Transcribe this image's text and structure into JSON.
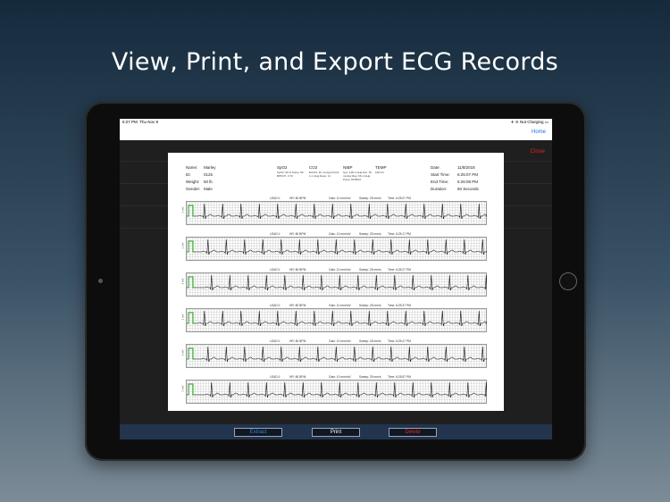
{
  "headline": "View, Print, and Export ECG Records",
  "status_bar": {
    "time": "6:27 PM",
    "date": "Thu Nov 8",
    "battery": "Not Charging"
  },
  "nav": {
    "home_label": "Home"
  },
  "close_label": "Close",
  "buttons": {
    "extract": "Extract",
    "print": "Print",
    "delete": "Delete"
  },
  "record": {
    "name_label": "Name:",
    "name_value": "Marley",
    "id_label": "ID:",
    "id_value": "0125",
    "weight_label": "Weight:",
    "weight_value": "50 lb",
    "gender_label": "Gender:",
    "gender_value": "Male",
    "spo2_title": "SpO2",
    "spo2_detail": "SpO2: 99 %  Pulse: 80 BPM  PI: 3.70",
    "co2_title": "CO2",
    "co2_detail": "EtCO2: 40 mmHg  FiCO2: 1 mmHg  Resp: 11",
    "nibp_title": "NIBP",
    "nibp_detail": "Sys: 128 mmHg  Dia: 78 mmHg  Map: 96 mmHg  Pulse: 80 BPM",
    "temp_title": "TEMP",
    "temp_detail": "100.6 F",
    "date_label": "Date:",
    "date_value": "11/8/2018",
    "start_label": "Start Time:",
    "start_value": "6:25:07 PM",
    "end_label": "End Time:",
    "end_value": "6:26:08 PM",
    "duration_label": "Duration:",
    "duration_value": "60 Seconds"
  },
  "strips": [
    {
      "lead": "LEAD II",
      "hr": "HR: 80 BPM",
      "gain": "Gain: 10 mm/mV",
      "sweep": "Sweep: 25 mm/s",
      "time": "Time: 6:25:07 PM",
      "mv": "1 mV"
    },
    {
      "lead": "LEAD II",
      "hr": "HR: 80 BPM",
      "gain": "Gain: 10 mm/mV",
      "sweep": "Sweep: 25 mm/s",
      "time": "Time: 6:25:17 PM",
      "mv": "1 mV"
    },
    {
      "lead": "LEAD II",
      "hr": "HR: 80 BPM",
      "gain": "Gain: 10 mm/mV",
      "sweep": "Sweep: 25 mm/s",
      "time": "Time: 6:25:27 PM",
      "mv": "1 mV"
    },
    {
      "lead": "LEAD II",
      "hr": "HR: 80 BPM",
      "gain": "Gain: 10 mm/mV",
      "sweep": "Sweep: 25 mm/s",
      "time": "Time: 6:25:37 PM",
      "mv": "1 mV"
    },
    {
      "lead": "LEAD II",
      "hr": "HR: 80 BPM",
      "gain": "Gain: 10 mm/mV",
      "sweep": "Sweep: 25 mm/s",
      "time": "Time: 6:25:47 PM",
      "mv": "1 mV"
    },
    {
      "lead": "LEAD II",
      "hr": "HR: 80 BPM",
      "gain": "Gain: 10 mm/mV",
      "sweep": "Sweep: 25 mm/s",
      "time": "Time: 6:25:57 PM",
      "mv": "1 mV"
    }
  ],
  "colors": {
    "calibration": "#22aa22",
    "trace": "#111111",
    "close": "#e02222",
    "home": "#1a73e8",
    "delete": "#e02222",
    "extract": "#3b82d6"
  }
}
